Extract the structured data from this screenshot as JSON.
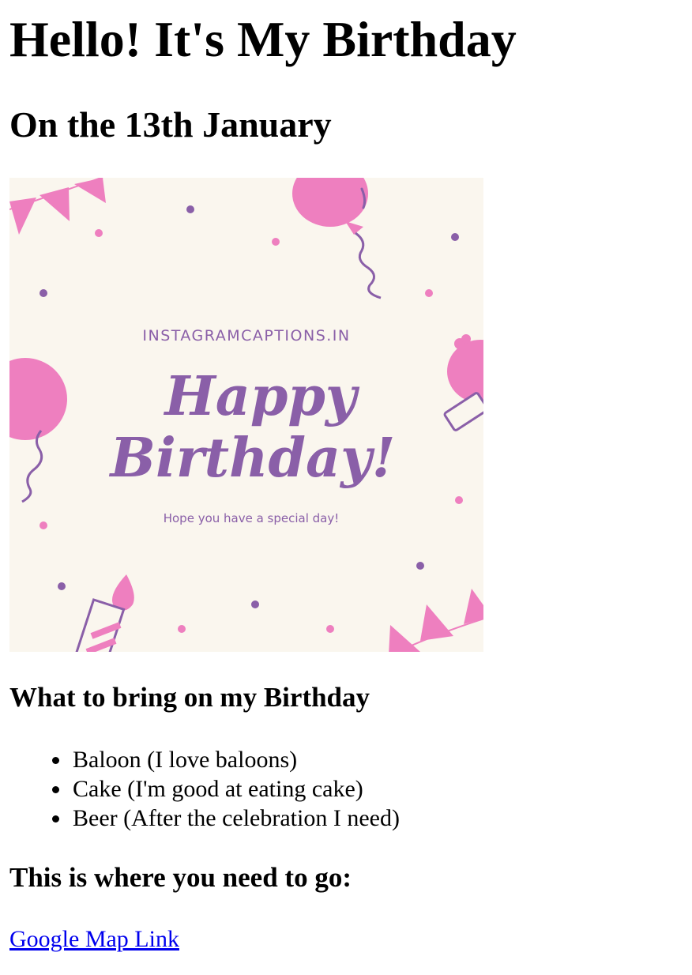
{
  "page": {
    "title": "Hello! It's My Birthday",
    "subtitle": "On the 13th January"
  },
  "card": {
    "site": "INSTAGRAMCAPTIONS.IN",
    "line1": "Happy",
    "line2": "Birthday!",
    "tagline": "Hope you have a special day!",
    "colors": {
      "background": "#faf6ee",
      "purple": "#8a5fa8",
      "pink": "#ee7fbf"
    }
  },
  "bring": {
    "heading": "What to bring on my Birthday",
    "items": [
      "Baloon (I love baloons)",
      "Cake (I'm good at eating cake)",
      "Beer (After the celebration I need)"
    ]
  },
  "directions": {
    "heading": "This is where you need to go:",
    "link_label": "Google Map Link"
  }
}
